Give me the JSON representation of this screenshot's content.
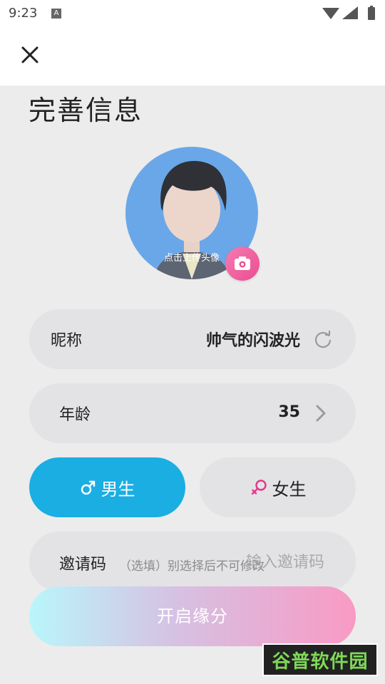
{
  "status": {
    "time": "9:23",
    "a_badge": "A"
  },
  "header": {
    "close_icon": "close-icon"
  },
  "page": {
    "title": "完善信息"
  },
  "avatar": {
    "hint": "点击上传头像",
    "camera_icon": "camera-icon"
  },
  "nickname": {
    "label": "昵称",
    "value": "帅气的闪波光",
    "refresh_icon": "refresh-icon"
  },
  "age": {
    "label": "年龄",
    "value": "35",
    "chevron_icon": "chevron-right-icon"
  },
  "gender": {
    "male_label": "男生",
    "female_label": "女生",
    "male_icon": "male-symbol-icon",
    "female_icon": "female-symbol-icon",
    "selected": "male",
    "colors": {
      "male_active": "#1aaee3",
      "female_icon": "#e8348c"
    }
  },
  "invite": {
    "label": "邀请码",
    "note": "（选填）别选择后不可修改",
    "placeholder": "输入邀请码",
    "value": ""
  },
  "submit": {
    "label": "开启缘分",
    "gradient": [
      "#b9f6fb",
      "#f99ac4"
    ]
  },
  "watermark": {
    "text": "谷普软件园"
  }
}
